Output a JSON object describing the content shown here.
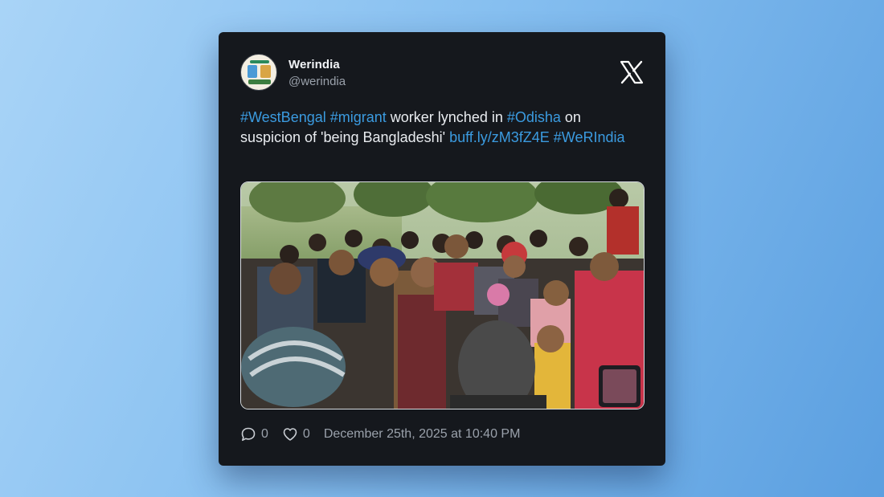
{
  "author": {
    "display_name": "Werindia",
    "handle": "@werindia"
  },
  "platform_logo": "x-logo-icon",
  "tweet": {
    "segments": [
      {
        "type": "hashtag",
        "text": "#WestBengal"
      },
      {
        "type": "text",
        "text": " "
      },
      {
        "type": "hashtag",
        "text": "#migrant"
      },
      {
        "type": "text",
        "text": " worker lynched in "
      },
      {
        "type": "hashtag",
        "text": "#Odisha"
      },
      {
        "type": "text",
        "text": " on suspicion of 'being Bangladeshi' "
      },
      {
        "type": "link",
        "text": "buff.ly/zM3fZ4E"
      },
      {
        "type": "text",
        "text": " "
      },
      {
        "type": "hashtag",
        "text": "#WeRIndia"
      }
    ]
  },
  "media": {
    "kind": "photo"
  },
  "footer": {
    "replies": "0",
    "likes": "0",
    "timestamp": "December 25th, 2025 at 10:40 PM"
  },
  "colors": {
    "background_start": "#a9d4f7",
    "background_end": "#5b9fe0",
    "card": "#15181d",
    "link": "#3b9be0",
    "text": "#e9ecf0",
    "muted": "#9aa1ab"
  }
}
